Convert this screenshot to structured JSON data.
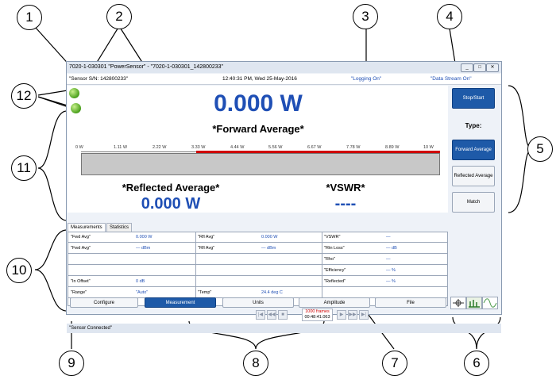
{
  "window": {
    "title": "7020-1-030301 \"PowerSensor\" - \"7020-1-030301_142800233\"",
    "controls": [
      "_",
      "□",
      "✕"
    ]
  },
  "infobar": {
    "serial": "\"Sensor S/N: 142800233\"",
    "datetime": "12:40:31 PM, Wed 25-May-2016",
    "logging": "\"Logging On\"",
    "datastream": "\"Data Stream On\""
  },
  "main": {
    "forward_value": "0.000 W",
    "forward_label": "*Forward Average*",
    "scale": [
      "0 W",
      "1.11 W",
      "2.22 W",
      "3.33 W",
      "4.44 W",
      "5.56 W",
      "6.67 W",
      "7.78 W",
      "8.89 W",
      "10 W"
    ],
    "reflected_label": "*Reflected Average*",
    "reflected_value": "0.000 W",
    "vswr_label": "*VSWR*",
    "vswr_value": "----"
  },
  "side": {
    "stop_start": "Stop/Start",
    "type_label": "Type:",
    "forward_average": "Forward Average",
    "reflected_average": "Reflected Average",
    "match": "Match"
  },
  "tabs": [
    "Measurements",
    "Statistics"
  ],
  "grid": [
    [
      "\"Fwd Avg\"",
      "0.000 W",
      "\"Rfl Avg\"",
      "0.000 W",
      "\"VSWR\"",
      "—"
    ],
    [
      "\"Fwd Avg\"",
      "— dBm",
      "\"Rfl Avg\"",
      "— dBm",
      "\"Rtn Loss\"",
      "— dB"
    ],
    [
      "",
      "",
      "",
      "",
      "\"Rho\"",
      "—"
    ],
    [
      "",
      "",
      "",
      "",
      "\"Efficiency\"",
      "— %"
    ],
    [
      "\"In Offset\"",
      "0 dB",
      "",
      "",
      "\"Reflected\"",
      "— %"
    ],
    [
      "\"Range\"",
      "\"Auto\"",
      "\"Temp\"",
      "24.4 deg C",
      "",
      ""
    ]
  ],
  "toolbar": {
    "configure": "Configure",
    "measurement": "Measurement",
    "units": "Units",
    "amplitude": "Amplitude",
    "file": "File"
  },
  "playback": {
    "frames": "1000 frames",
    "time": "00:48:41.063",
    "buttons": [
      "|◀",
      "◀◀",
      "■",
      "▶",
      "▶▶",
      "▶|"
    ]
  },
  "status": "\"Sensor Connected\"",
  "callouts": [
    "1",
    "2",
    "3",
    "4",
    "5",
    "6",
    "7",
    "8",
    "9",
    "10",
    "11",
    "12"
  ]
}
